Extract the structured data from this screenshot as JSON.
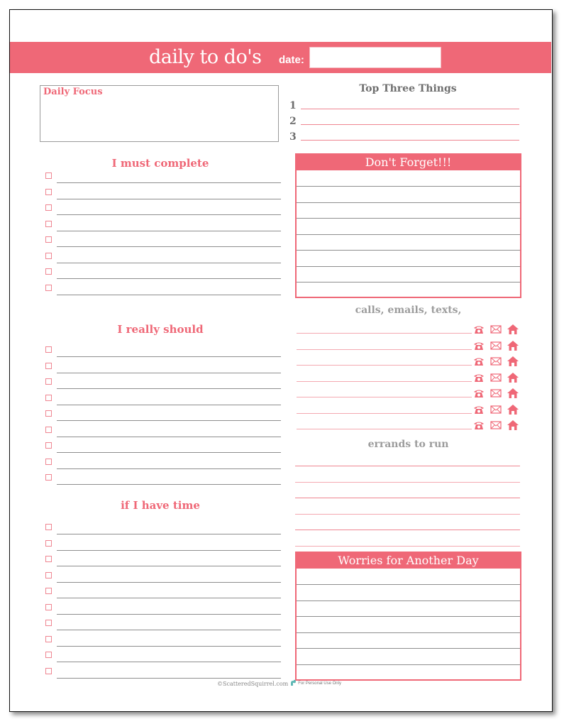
{
  "header": {
    "title": "daily to do's",
    "date_label": "date:",
    "date_value": ""
  },
  "daily_focus": {
    "label": "Daily Focus",
    "value": ""
  },
  "top_three": {
    "title": "Top Three Things",
    "items": [
      {
        "number": "1",
        "value": ""
      },
      {
        "number": "2",
        "value": ""
      },
      {
        "number": "3",
        "value": ""
      }
    ]
  },
  "must_complete": {
    "title": "I must complete",
    "item_count": 8
  },
  "really_should": {
    "title": "I really should",
    "item_count": 9
  },
  "if_time": {
    "title": "if I have time",
    "item_count": 10
  },
  "dont_forget": {
    "title": "Don't Forget!!!",
    "line_count": 8
  },
  "contacts": {
    "title": "calls, emails, texts,",
    "row_count": 7,
    "icons": [
      "phone-icon",
      "envelope-icon",
      "home-icon"
    ]
  },
  "errands": {
    "title": "errands to run",
    "line_count": 6
  },
  "worries": {
    "title": "Worries for Another Day",
    "line_count": 7
  },
  "footer": {
    "copyright": "©ScatteredSquirrel.com",
    "note": "For Personal Use Only"
  },
  "colors": {
    "accent": "#ef6877",
    "line_gray": "#8e8e8e",
    "title_gray": "#9c9c9c"
  }
}
